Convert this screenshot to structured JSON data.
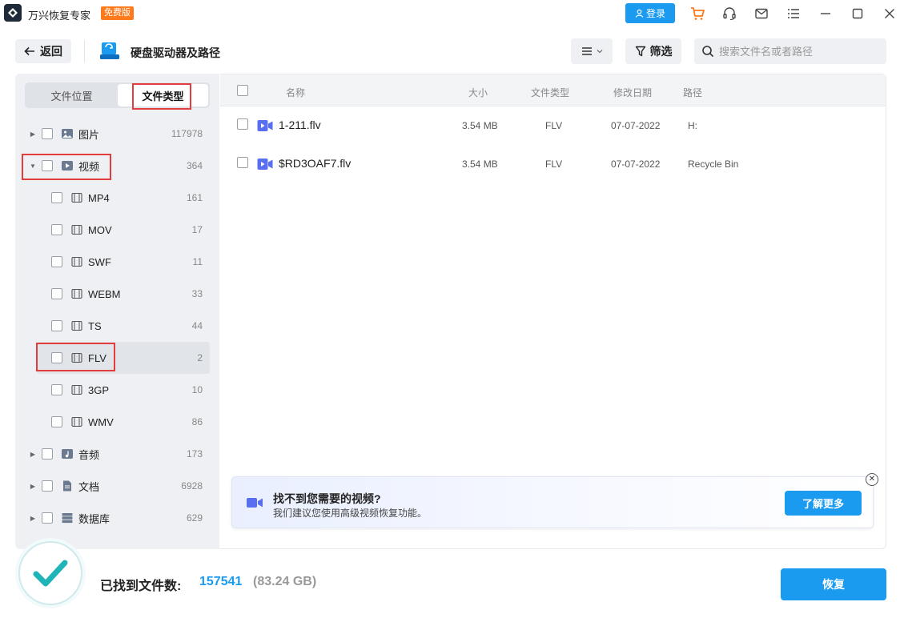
{
  "app": {
    "title": "万兴恢复专家",
    "edition_badge": "免费版",
    "login_label": "登录"
  },
  "window_icons": [
    "cart-icon",
    "headset-icon",
    "mail-icon",
    "menu-list-icon",
    "minimize-icon",
    "maximize-icon",
    "close-icon"
  ],
  "toolbar": {
    "back_label": "返回",
    "page_title": "硬盘驱动器及路径",
    "filter_label": "筛选",
    "search_placeholder": "搜索文件名或者路径"
  },
  "left_tabs": [
    {
      "label": "文件位置",
      "active": false
    },
    {
      "label": "文件类型",
      "active": true
    }
  ],
  "tree": [
    {
      "label": "图片",
      "count": "117978",
      "icon": "image-icon",
      "level": 0,
      "expanded": false
    },
    {
      "label": "视频",
      "count": "364",
      "icon": "video-icon",
      "level": 0,
      "expanded": true
    },
    {
      "label": "MP4",
      "count": "161",
      "icon": "video-file-icon",
      "level": 1
    },
    {
      "label": "MOV",
      "count": "17",
      "icon": "video-file-icon",
      "level": 1
    },
    {
      "label": "SWF",
      "count": "11",
      "icon": "video-file-icon",
      "level": 1
    },
    {
      "label": "WEBM",
      "count": "33",
      "icon": "video-file-icon",
      "level": 1
    },
    {
      "label": "TS",
      "count": "44",
      "icon": "video-file-icon",
      "level": 1
    },
    {
      "label": "FLV",
      "count": "2",
      "icon": "video-file-icon",
      "level": 1,
      "selected": true
    },
    {
      "label": "3GP",
      "count": "10",
      "icon": "video-file-icon",
      "level": 1
    },
    {
      "label": "WMV",
      "count": "86",
      "icon": "video-file-icon",
      "level": 1
    },
    {
      "label": "音频",
      "count": "173",
      "icon": "audio-icon",
      "level": 0,
      "expanded": false
    },
    {
      "label": "文档",
      "count": "6928",
      "icon": "document-icon",
      "level": 0,
      "expanded": false
    },
    {
      "label": "数据库",
      "count": "629",
      "icon": "database-icon",
      "level": 0,
      "expanded": false
    }
  ],
  "list": {
    "columns": [
      "名称",
      "大小",
      "文件类型",
      "修改日期",
      "路径"
    ],
    "rows": [
      {
        "name": "1-211.flv",
        "size": "3.54 MB",
        "type": "FLV",
        "date": "07-07-2022",
        "path": "H:"
      },
      {
        "name": "$RD3OAF7.flv",
        "size": "3.54 MB",
        "type": "FLV",
        "date": "07-07-2022",
        "path": "Recycle Bin"
      }
    ]
  },
  "tip": {
    "title": "找不到您需要的视频?",
    "subtitle": "我们建议您使用高级视频恢复功能。",
    "button": "了解更多"
  },
  "footer": {
    "found_label": "已找到文件数:",
    "found_count": "157541",
    "found_size": "(83.24 GB)",
    "recover_label": "恢复"
  },
  "colors": {
    "accent": "#1a9bf0",
    "badge": "#ff7a1a",
    "highlight": "#e33c3c",
    "video_icon": "#5a6ff0"
  }
}
